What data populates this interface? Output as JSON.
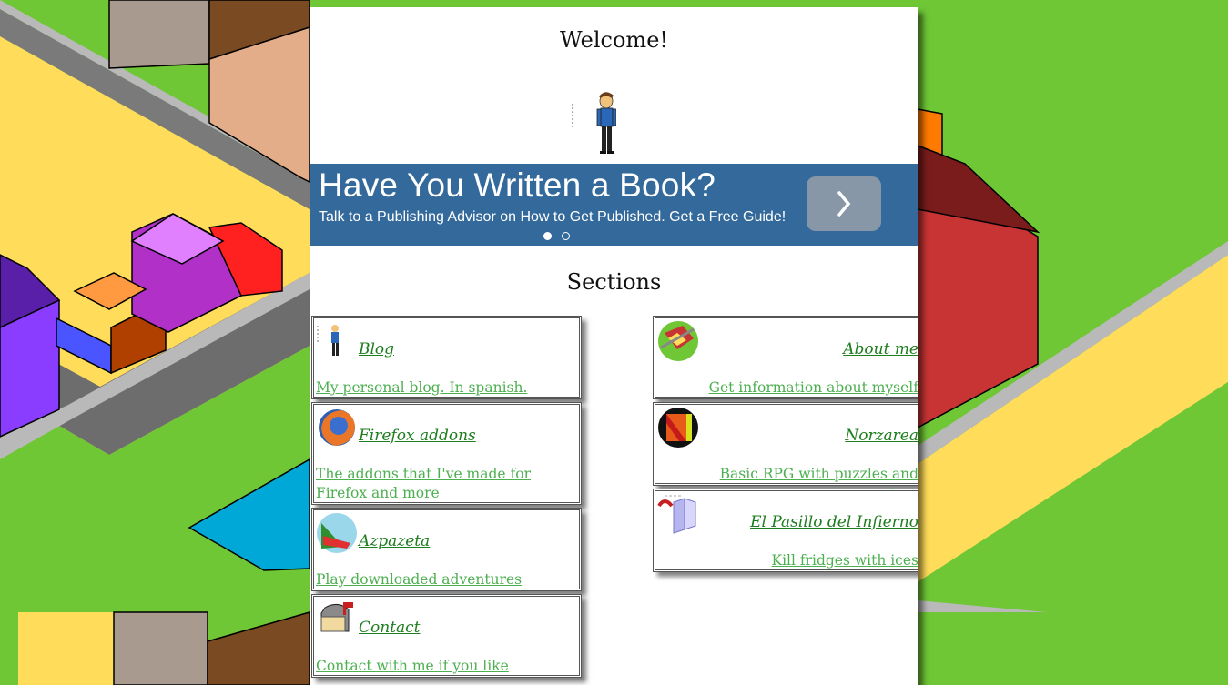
{
  "page": {
    "welcome": "Welcome!",
    "sections_title": "Sections"
  },
  "ad": {
    "title": "Have You Written a Book?",
    "subtitle": "Talk to a Publishing Advisor on How to Get Published. Get a Free Guide!",
    "dots_total": 2,
    "active_dot": 1
  },
  "sections": {
    "blog": {
      "name": "Blog",
      "desc": "My personal blog. In spanish.",
      "icon": "avatar-icon"
    },
    "firefox": {
      "name": "Firefox addons",
      "desc": "The addons that I've made for Firefox and more",
      "icon": "firefox-icon"
    },
    "azpazeta": {
      "name": "Azpazeta",
      "desc": "Play downloaded adventures",
      "icon": "azpazeta-icon"
    },
    "contact": {
      "name": "Contact",
      "desc": "Contact with me if you like",
      "icon": "mailbox-icon"
    },
    "about": {
      "name": "About me",
      "desc": "Get information about myself",
      "icon": "city-map-icon"
    },
    "norzarea": {
      "name": "Norzarea",
      "desc": "Basic RPG with puzzles and monsters",
      "icon": "norzarea-icon"
    },
    "pasillo": {
      "name": "El Pasillo del Infierno",
      "desc": "Kill fridges with ices",
      "icon": "fridge-icon"
    }
  },
  "colors": {
    "background": "#6fc736",
    "ad_bar": "#346a9b",
    "link_title": "#1e7d1e",
    "link_desc": "#4caf50"
  }
}
